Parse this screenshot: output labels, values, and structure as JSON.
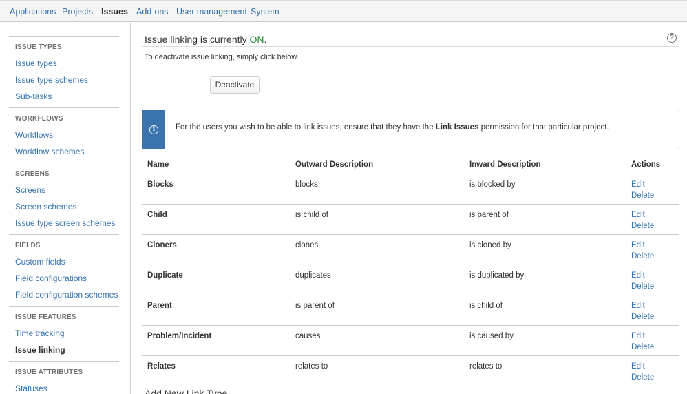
{
  "nav": {
    "tabs": [
      {
        "label": "Applications",
        "active": false
      },
      {
        "label": "Projects",
        "active": false
      },
      {
        "label": "Issues",
        "active": true
      },
      {
        "label": "Add-ons",
        "active": false
      },
      {
        "label": "User management",
        "active": false
      },
      {
        "label": "System",
        "active": false
      }
    ]
  },
  "sidebar": {
    "sections": [
      {
        "heading": "ISSUE TYPES",
        "items": [
          "Issue types",
          "Issue type schemes",
          "Sub-tasks"
        ]
      },
      {
        "heading": "WORKFLOWS",
        "items": [
          "Workflows",
          "Workflow schemes"
        ]
      },
      {
        "heading": "SCREENS",
        "items": [
          "Screens",
          "Screen schemes",
          "Issue type screen schemes"
        ]
      },
      {
        "heading": "FIELDS",
        "items": [
          "Custom fields",
          "Field configurations",
          "Field configuration schemes"
        ]
      },
      {
        "heading": "ISSUE FEATURES",
        "items": [
          "Time tracking",
          "Issue linking"
        ],
        "selected": "Issue linking"
      },
      {
        "heading": "ISSUE ATTRIBUTES",
        "items": [
          "Statuses"
        ]
      }
    ]
  },
  "main": {
    "status_prefix": "Issue linking is currently ",
    "status_value": "ON",
    "status_suffix": ".",
    "help_icon": "question-circle-icon",
    "description": "To deactivate issue linking, simply click below.",
    "deactivate_label": "Deactivate",
    "info": {
      "icon": "info-circle-icon",
      "text_before": "For the users you wish to be able to link issues, ensure that they have the ",
      "text_bold": "Link Issues",
      "text_after": " permission for that particular project."
    },
    "table": {
      "headers": {
        "name": "Name",
        "outward": "Outward Description",
        "inward": "Inward Description",
        "actions": "Actions"
      },
      "edit_label": "Edit",
      "delete_label": "Delete",
      "rows": [
        {
          "name": "Blocks",
          "outward": "blocks",
          "inward": "is blocked by"
        },
        {
          "name": "Child",
          "outward": "is child of",
          "inward": "is parent of"
        },
        {
          "name": "Cloners",
          "outward": "clones",
          "inward": "is cloned by"
        },
        {
          "name": "Duplicate",
          "outward": "duplicates",
          "inward": "is duplicated by"
        },
        {
          "name": "Parent",
          "outward": "is parent of",
          "inward": "is child of"
        },
        {
          "name": "Problem/Incident",
          "outward": "causes",
          "inward": "is caused by"
        },
        {
          "name": "Relates",
          "outward": "relates to",
          "inward": "relates to"
        }
      ]
    },
    "add_new_title": "Add New Link Type"
  },
  "colors": {
    "link": "#3572b0",
    "on": "#14892c",
    "info_border": "#3b73af"
  }
}
